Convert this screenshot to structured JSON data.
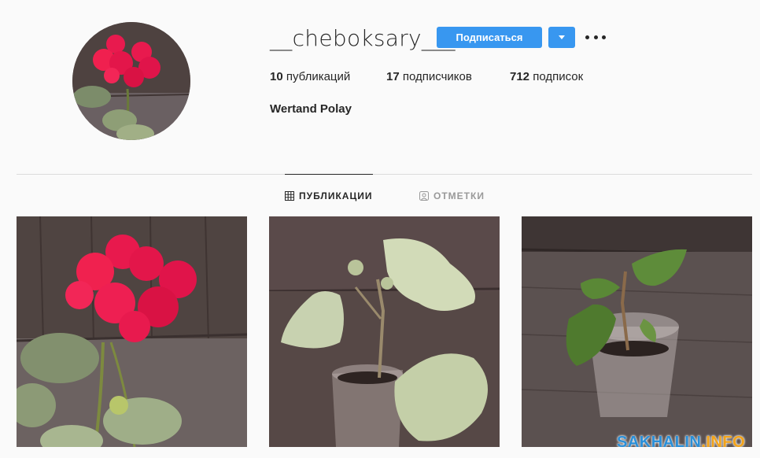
{
  "profile": {
    "username": "__cheboksary___",
    "full_name": "Wertand Polay",
    "follow_label": "Подписаться",
    "avatar_alt": "profile-photo-red-geranium"
  },
  "stats": [
    {
      "count": "10",
      "label": "публикаций"
    },
    {
      "count": "17",
      "label": "подписчиков"
    },
    {
      "count": "712",
      "label": "подписок"
    }
  ],
  "tabs": [
    {
      "label": "ПУБЛИКАЦИИ",
      "icon": "grid-icon",
      "active": true
    },
    {
      "label": "ОТМЕТКИ",
      "icon": "tagged-person-icon",
      "active": false
    }
  ],
  "posts": [
    {
      "subject": "red geranium flower"
    },
    {
      "subject": "geranium seedling in plastic cup"
    },
    {
      "subject": "young plant in plastic cup"
    }
  ],
  "watermark": {
    "part1": "SAKHALIN",
    "part2": ".INFO"
  },
  "colors": {
    "accent": "#3897f0",
    "divider": "#dbdbdb",
    "background": "#fafafa"
  }
}
